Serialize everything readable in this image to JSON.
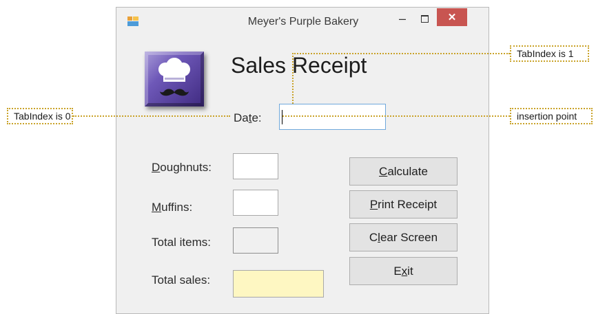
{
  "window": {
    "title": "Meyer's Purple Bakery",
    "minimize_glyph": "–",
    "close_glyph": "✕"
  },
  "form": {
    "heading": "Sales Receipt",
    "date_label": {
      "pre": "Da",
      "access": "t",
      "post": "e:"
    },
    "doughnuts_label": {
      "pre": "",
      "access": "D",
      "post": "oughnuts:"
    },
    "muffins_label": {
      "pre": "",
      "access": "M",
      "post": "uffins:"
    },
    "total_items_label": "Total items:",
    "total_sales_label": "Total sales:",
    "date_value": "",
    "doughnuts_value": "",
    "muffins_value": "",
    "total_items_value": "",
    "total_sales_value": ""
  },
  "buttons": {
    "calculate": {
      "pre": "",
      "access": "C",
      "post": "alculate"
    },
    "print": {
      "pre": "",
      "access": "P",
      "post": "rint Receipt"
    },
    "clear": {
      "pre": "C",
      "access": "l",
      "post": "ear Screen"
    },
    "exit": {
      "pre": "E",
      "access": "x",
      "post": "it"
    }
  },
  "callouts": {
    "tabindex_0": "TabIndex is 0",
    "tabindex_1": "TabIndex is 1",
    "insertion_point": "insertion point"
  },
  "colors": {
    "close_button": "#c85551",
    "total_sales_bg": "#fef7c2",
    "callout_border": "#c9a227",
    "logo_purple": "#6e58b8"
  }
}
